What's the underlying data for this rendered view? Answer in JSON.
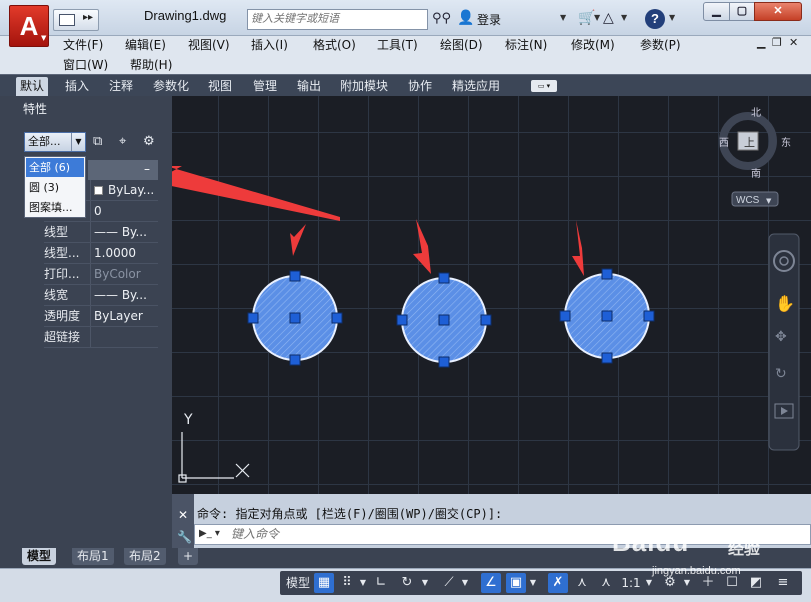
{
  "app": {
    "logo_letter": "A",
    "document_title": "Drawing1.dwg",
    "search_placeholder": "键入关键字或短语",
    "login_label": "登录"
  },
  "menus": {
    "row1": [
      "文件(F)",
      "编辑(E)",
      "视图(V)",
      "插入(I)",
      "格式(O)",
      "工具(T)",
      "绘图(D)",
      "标注(N)",
      "修改(M)",
      "参数(P)"
    ],
    "row2": [
      "窗口(W)",
      "帮助(H)"
    ]
  },
  "ribbon_tabs": [
    "默认",
    "插入",
    "注释",
    "参数化",
    "视图",
    "管理",
    "输出",
    "附加模块",
    "协作",
    "精选应用"
  ],
  "active_ribbon_tab": 0,
  "properties": {
    "title": "特性",
    "selection_combo": "全部...",
    "dropdown_options": [
      "全部 (6)",
      "圆 (3)",
      "图案填..."
    ],
    "selected_option": 0,
    "collapse_symbol": "–",
    "rows": [
      {
        "label": "",
        "value": "ByLay..."
      },
      {
        "label": "",
        "value": "0"
      },
      {
        "label": "线型",
        "value": "—— By..."
      },
      {
        "label": "线型...",
        "value": "1.0000"
      },
      {
        "label": "打印...",
        "value": "ByColor"
      },
      {
        "label": "线宽",
        "value": "—— By..."
      },
      {
        "label": "透明度",
        "value": "ByLayer"
      },
      {
        "label": "超链接",
        "value": ""
      }
    ]
  },
  "viewcube": {
    "north": "北",
    "south": "南",
    "east": "东",
    "west": "西",
    "top_face": "上",
    "wcs": "WCS"
  },
  "ucs": {
    "y_label": "Y"
  },
  "drawing": {
    "circle_color": "#5b8fe6",
    "grip_color": "#1e5fd6",
    "arrow_color": "#ee3b3b",
    "selected_circles": 3
  },
  "command": {
    "history": "命令: 指定对角点或 [栏选(F)/圈围(WP)/圈交(CP)]:",
    "placeholder": "键入命令"
  },
  "layout_tabs": [
    "模型",
    "布局1",
    "布局2"
  ],
  "layout_add": "+",
  "status": {
    "model_label": "模型",
    "scale_label": "1:1"
  },
  "watermark": {
    "logo": "Baidu",
    "jingyan": "经验",
    "url": "jingyan.baidu.com"
  }
}
